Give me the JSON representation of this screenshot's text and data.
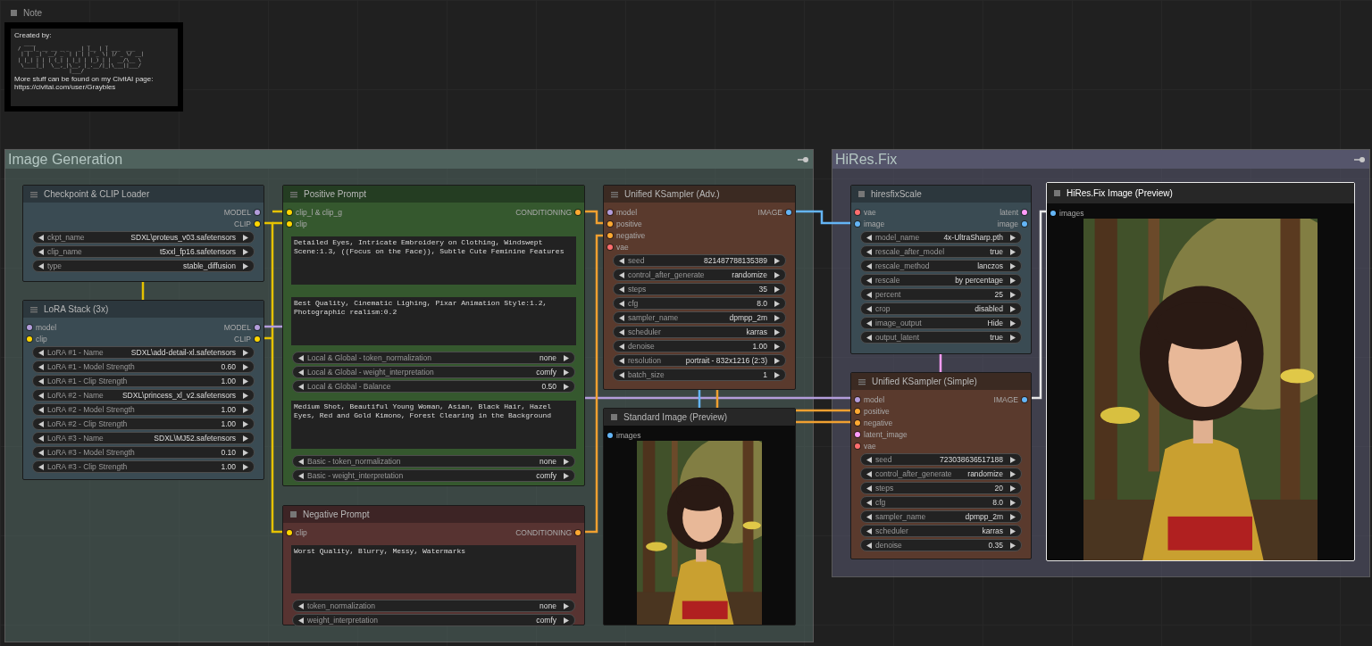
{
  "note": {
    "title": "Note",
    "selected": false,
    "header": "Created by:",
    "art": [
      "  ____                 _     _",
      "/ ___|_ __ __ _ _   _| |__ | | ___  ___",
      " | |  _| '__/ _` | | | | '_ \\| |/ _ \\/ __|",
      "| |_| | | | (_| | |_| | |_) | |  __/\\__ \\",
      " \\____|_|  \\__,_|\\__, |_.__/|_|\\___||___/",
      "                 |___/"
    ],
    "footer": [
      "More stuff can be found on my CivitAI page:",
      "https://civitai.com/user/Graybles"
    ]
  },
  "groups": [
    {
      "title": "Image Generation",
      "color": "#4f625d",
      "nodes": [
        {
          "title": "Checkpoint & CLIP Loader",
          "selected": false,
          "outputs": [
            {
              "label": "MODEL",
              "color": "#b39ddb"
            },
            {
              "label": "CLIP",
              "color": "#ffd500"
            }
          ],
          "items": [
            {
              "kind": "widget",
              "label": "ckpt_name",
              "value": "SDXL\\proteus_v03.safetensors"
            },
            {
              "kind": "widget",
              "label": "clip_name",
              "value": "t5xxl_fp16.safetensors"
            },
            {
              "kind": "widget",
              "label": "type",
              "value": "stable_diffusion"
            }
          ]
        },
        {
          "title": "LoRA Stack (3x)",
          "selected": false,
          "inputs": [
            {
              "label": "model",
              "color": "#b39ddb"
            },
            {
              "label": "clip",
              "color": "#ffd500"
            }
          ],
          "outputs": [
            {
              "label": "MODEL",
              "color": "#b39ddb"
            },
            {
              "label": "CLIP",
              "color": "#ffd500"
            }
          ],
          "items": [
            {
              "kind": "widget",
              "label": "LoRA #1 - Name",
              "value": "SDXL\\add-detail-xl.safetensors"
            },
            {
              "kind": "widget",
              "label": "LoRA #1 - Model Strength",
              "value": "0.60"
            },
            {
              "kind": "widget",
              "label": "LoRA #1 - Clip Strength",
              "value": "1.00"
            },
            {
              "kind": "widget",
              "label": "LoRA #2 - Name",
              "value": "SDXL\\princess_xl_v2.safetensors"
            },
            {
              "kind": "widget",
              "label": "LoRA #2 - Model Strength",
              "value": "1.00"
            },
            {
              "kind": "widget",
              "label": "LoRA #2 - Clip Strength",
              "value": "1.00"
            },
            {
              "kind": "widget",
              "label": "LoRA #3 - Name",
              "value": "SDXL\\MJ52.safetensors"
            },
            {
              "kind": "widget",
              "label": "LoRA #3 - Model Strength",
              "value": "0.10"
            },
            {
              "kind": "widget",
              "label": "LoRA #3 - Clip Strength",
              "value": "1.00"
            }
          ]
        },
        {
          "title": "Positive Prompt",
          "selected": false,
          "inputs": [
            {
              "label": "clip_l & clip_g",
              "color": "#ffd500"
            },
            {
              "label": "clip",
              "color": "#ffd500"
            }
          ],
          "outputs": [
            {
              "label": "CONDITIONING",
              "color": "#ffa931"
            }
          ],
          "items": [
            {
              "kind": "text",
              "value": "Detailed Eyes, Intricate Embroidery on Clothing, Windswept Scene:1.3, ((Focus on the Face)), Subtle Cute Feminine Features"
            },
            {
              "kind": "text",
              "value": "Best Quality, Cinematic Lighing, Pixar Animation Style:1.2, Photographic realism:0.2"
            },
            {
              "kind": "widget",
              "label": "Local & Global - token_normalization",
              "value": "none"
            },
            {
              "kind": "widget",
              "label": "Local & Global - weight_interpretation",
              "value": "comfy"
            },
            {
              "kind": "widget",
              "label": "Local & Global - Balance",
              "value": "0.50"
            },
            {
              "kind": "text",
              "value": "Medium Shot, Beautiful Young Woman, Asian, Black Hair, Hazel Eyes, Red and Gold Kimono, Forest Clearing in the Background"
            },
            {
              "kind": "widget",
              "label": "Basic - token_normalization",
              "value": "none"
            },
            {
              "kind": "widget",
              "label": "Basic - weight_interpretation",
              "value": "comfy"
            }
          ]
        },
        {
          "title": "Negative Prompt",
          "selected": false,
          "inputs": [
            {
              "label": "clip",
              "color": "#ffd500"
            }
          ],
          "outputs": [
            {
              "label": "CONDITIONING",
              "color": "#ffa931"
            }
          ],
          "items": [
            {
              "kind": "text",
              "value": "Worst Quality, Blurry, Messy, Watermarks"
            },
            {
              "kind": "widget",
              "label": "token_normalization",
              "value": "none"
            },
            {
              "kind": "widget",
              "label": "weight_interpretation",
              "value": "comfy"
            }
          ]
        },
        {
          "title": "Unified KSampler (Adv.)",
          "selected": false,
          "inputs": [
            {
              "label": "model",
              "color": "#b39ddb"
            },
            {
              "label": "positive",
              "color": "#ffa931"
            },
            {
              "label": "negative",
              "color": "#ffa931"
            },
            {
              "label": "vae",
              "color": "#ff6e6e"
            }
          ],
          "outputs": [
            {
              "label": "IMAGE",
              "color": "#64b5f6"
            }
          ],
          "items": [
            {
              "kind": "widget",
              "label": "seed",
              "value": "821487788135389"
            },
            {
              "kind": "widget",
              "label": "control_after_generate",
              "value": "randomize"
            },
            {
              "kind": "widget",
              "label": "steps",
              "value": "35"
            },
            {
              "kind": "widget",
              "label": "cfg",
              "value": "8.0"
            },
            {
              "kind": "widget",
              "label": "sampler_name",
              "value": "dpmpp_2m"
            },
            {
              "kind": "widget",
              "label": "scheduler",
              "value": "karras"
            },
            {
              "kind": "widget",
              "label": "denoise",
              "value": "1.00"
            },
            {
              "kind": "widget",
              "label": "resolution",
              "value": "portrait - 832x1216 (2:3)"
            },
            {
              "kind": "widget",
              "label": "batch_size",
              "value": "1"
            }
          ]
        },
        {
          "title": "Standard Image (Preview)",
          "selected": false,
          "inputs": [
            {
              "label": "images",
              "color": "#64b5f6"
            }
          ],
          "items": [
            {
              "kind": "picture"
            }
          ]
        }
      ]
    },
    {
      "title": "HiRes.Fix",
      "color": "#55556b",
      "nodes": [
        {
          "title": "hiresfixScale",
          "selected": false,
          "inputs": [
            {
              "label": "vae",
              "color": "#ff6e6e"
            },
            {
              "label": "image",
              "color": "#64b5f6"
            }
          ],
          "outputs": [
            {
              "label": "latent",
              "color": "#ff9cf9"
            },
            {
              "label": "image",
              "color": "#64b5f6"
            }
          ],
          "items": [
            {
              "kind": "widget",
              "label": "model_name",
              "value": "4x-UltraSharp.pth"
            },
            {
              "kind": "widget",
              "label": "rescale_after_model",
              "value": "true"
            },
            {
              "kind": "widget",
              "label": "rescale_method",
              "value": "lanczos"
            },
            {
              "kind": "widget",
              "label": "rescale",
              "value": "by percentage"
            },
            {
              "kind": "widget",
              "label": "percent",
              "value": "25"
            },
            {
              "kind": "widget",
              "label": "crop",
              "value": "disabled"
            },
            {
              "kind": "widget",
              "label": "image_output",
              "value": "Hide"
            },
            {
              "kind": "widget",
              "label": "output_latent",
              "value": "true"
            }
          ]
        },
        {
          "title": "Unified KSampler (Simple)",
          "selected": false,
          "inputs": [
            {
              "label": "model",
              "color": "#b39ddb"
            },
            {
              "label": "positive",
              "color": "#ffa931"
            },
            {
              "label": "negative",
              "color": "#ffa931"
            },
            {
              "label": "latent_image",
              "color": "#ff9cf9"
            },
            {
              "label": "vae",
              "color": "#ff6e6e"
            }
          ],
          "outputs": [
            {
              "label": "IMAGE",
              "color": "#64b5f6"
            }
          ],
          "items": [
            {
              "kind": "widget",
              "label": "seed",
              "value": "723038636517188"
            },
            {
              "kind": "widget",
              "label": "control_after_generate",
              "value": "randomize"
            },
            {
              "kind": "widget",
              "label": "steps",
              "value": "20"
            },
            {
              "kind": "widget",
              "label": "cfg",
              "value": "8.0"
            },
            {
              "kind": "widget",
              "label": "sampler_name",
              "value": "dpmpp_2m"
            },
            {
              "kind": "widget",
              "label": "scheduler",
              "value": "karras"
            },
            {
              "kind": "widget",
              "label": "denoise",
              "value": "0.35"
            }
          ]
        },
        {
          "title": "HiRes.Fix Image (Preview)",
          "selected": true,
          "inputs": [
            {
              "label": "images",
              "color": "#64b5f6"
            }
          ],
          "items": [
            {
              "kind": "picture"
            }
          ]
        }
      ]
    }
  ]
}
